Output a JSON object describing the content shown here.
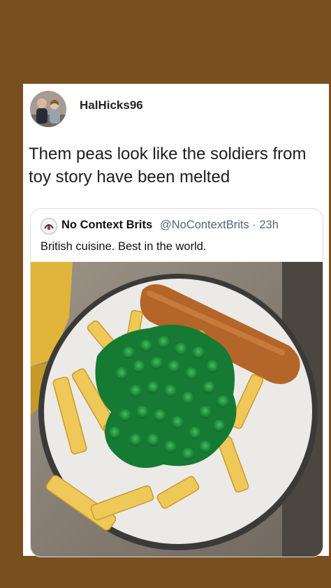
{
  "tweet": {
    "username": "HalHicks96",
    "text": "Them peas look like the soldiers from toy story have been melted"
  },
  "quoted_tweet": {
    "display_name": "No Context Brits",
    "handle_and_time": "@NoContextBrits · 23h",
    "text": "British cuisine. Best in the world."
  },
  "icons": {
    "avatar": "profile-photo",
    "quoted_avatar": "no-context-brits-logo"
  },
  "colors": {
    "frame": "#7a4f1f",
    "card": "#ffffff",
    "border": "#d8dde2",
    "peas": "#1f8a3a",
    "handle": "#536471"
  }
}
